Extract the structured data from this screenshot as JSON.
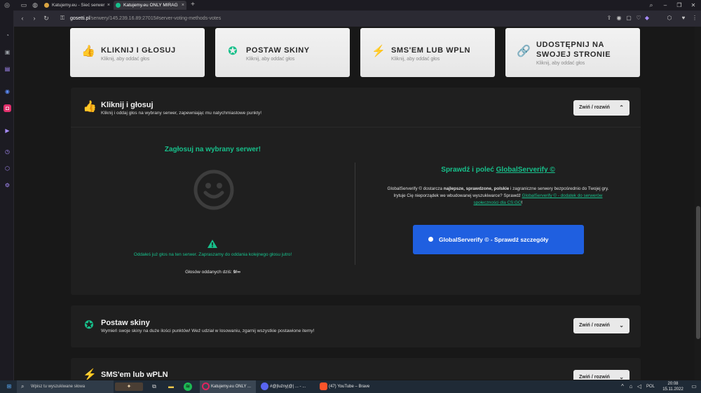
{
  "browser": {
    "tabs": [
      {
        "label": "Katujemy.eu - Sieć serwer",
        "active": false
      },
      {
        "label": "Katujemy.eu ONLY MIRAG",
        "active": true
      }
    ],
    "new_tab": "+",
    "url_host": "gosetti.pl",
    "url_path": "/serwery/145.239.16.89:27015#server-voting-methods-votes"
  },
  "methods": [
    {
      "title": "KLIKNIJ I GŁOSUJ",
      "subtitle": "Kliknij, aby oddać głos",
      "icon": "thumbs-up-icon"
    },
    {
      "title": "POSTAW SKINY",
      "subtitle": "Kliknij, aby oddać głos",
      "icon": "award-icon"
    },
    {
      "title": "SMS'EM LUB WPLN",
      "subtitle": "Kliknij, aby oddać głos",
      "icon": "bolt-icon"
    },
    {
      "title": "UDOSTĘPNIJ NA SWOJEJ STRONIE",
      "title_line1": "UDOSTĘPNIJ NA",
      "title_line2": "SWOJEJ STRONIE",
      "subtitle": "Kliknij, aby oddać głos",
      "icon": "link-icon"
    }
  ],
  "vote_section": {
    "title": "Kliknij i głosuj",
    "description": "Kliknij i oddaj głos na wybrany serwer, zapewniając mu natychmiastowe punkty!",
    "toggle": "Zwiń / rozwiń",
    "left": {
      "heading": "Zagłosuj na wybrany serwer!",
      "notice": "Oddałeś już głos na ten serwer. Zapraszamy do oddania kolejnego głosu jutro!",
      "count_label": "Głosów oddanych dziś:",
      "count_value": "9/∞"
    },
    "right": {
      "heading_prefix": "Sprawdź i poleć ",
      "heading_link": "GlobalServerify ©",
      "line1_a": "GlobalServerify © dostarcza ",
      "line1_b": "najlepsze, sprawdzone, polskie",
      "line1_c": " i zagraniczne serwery bezpośrednio do Twojej gry.",
      "line2_a": "Irytuje Cię nieporządek we wbudowanej wyszukiwarce? Sprawdź ",
      "line2_link": "GlobalServerify © - dodatek do serwerów",
      "line3_link": "społeczności dla CS:GO",
      "line3_end": "!",
      "button": "GlobalServerify © - Sprawdź szczegóły"
    }
  },
  "skins_section": {
    "title": "Postaw skiny",
    "description": "Wymień swoje skiny na duże ilości punktów! Weź udział w losowaniu, zgarnij wszystkie postawione itemy!",
    "toggle": "Zwiń / rozwiń"
  },
  "sms_section": {
    "title": "SMS'em lub wPLN",
    "toggle": "Zwiń / rozwiń"
  },
  "taskbar": {
    "search_placeholder": "Wpisz tu wyszukiwane słowa",
    "apps": [
      {
        "label": "Katujemy.eu ONLY ..."
      },
      {
        "label": "#@|luźny|@| ... - ..."
      },
      {
        "label": "(47) YouTube – Brave"
      }
    ],
    "language": "POL",
    "time": "20:08",
    "date": "15.11.2022"
  },
  "colors": {
    "accent_green": "#17c08b",
    "button_blue": "#1f5fe0",
    "panel_dark": "#1f1f1f"
  }
}
